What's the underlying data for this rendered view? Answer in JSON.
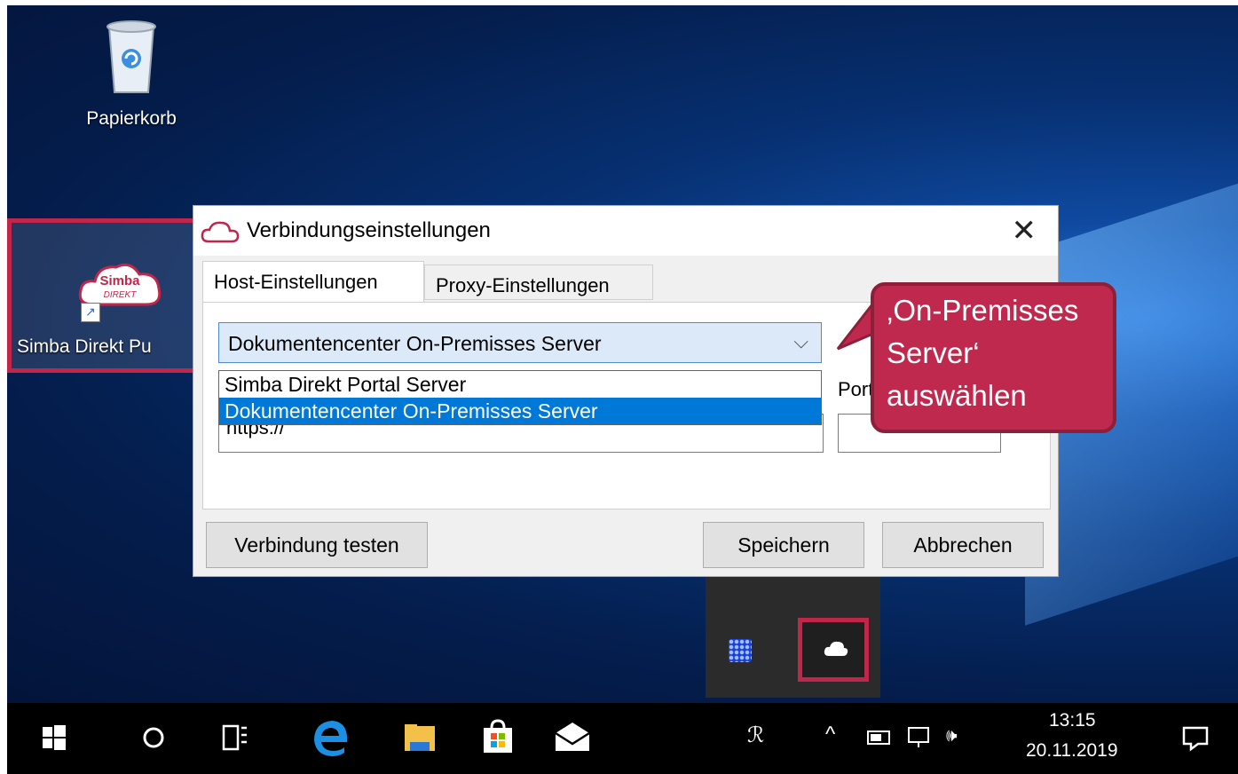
{
  "desktop": {
    "recycle_bin_label": "Papierkorb",
    "simba_label": "Simba Direkt Pu",
    "simba_logo_line1": "Simba",
    "simba_logo_line2": "DIREKT"
  },
  "dialog": {
    "title": "Verbindungseinstellungen",
    "close_glyph": "✕",
    "tabs": [
      {
        "label": "Host-Einstellungen"
      },
      {
        "label": "Proxy-Einstellungen"
      }
    ],
    "server_combo": {
      "selected": "Dokumentencenter On-Premisses Server",
      "chevron": "⌵",
      "options": [
        {
          "label": "Simba Direkt Portal Server"
        },
        {
          "label": "Dokumentencenter On-Premisses Server"
        }
      ]
    },
    "url_value": "https://",
    "port_label": "Port",
    "buttons": {
      "test": "Verbindung testen",
      "save": "Speichern",
      "cancel": "Abbrechen"
    }
  },
  "callout": {
    "line1": "‚On-Premisses",
    "line2": "Server‘",
    "line3": "auswählen"
  },
  "taskbar": {
    "icons": [
      "windows-start-icon",
      "cortana-icon",
      "task-view-icon",
      "edge-icon",
      "file-explorer-icon",
      "store-icon",
      "mail-icon"
    ],
    "tray": {
      "people_glyph": "ℛ",
      "chevron_glyph": "^",
      "volume_glyph": "🕪"
    },
    "time": "13:15",
    "date": "20.11.2019"
  },
  "colors": {
    "accent": "#c0264a",
    "selection": "#0078d7"
  }
}
